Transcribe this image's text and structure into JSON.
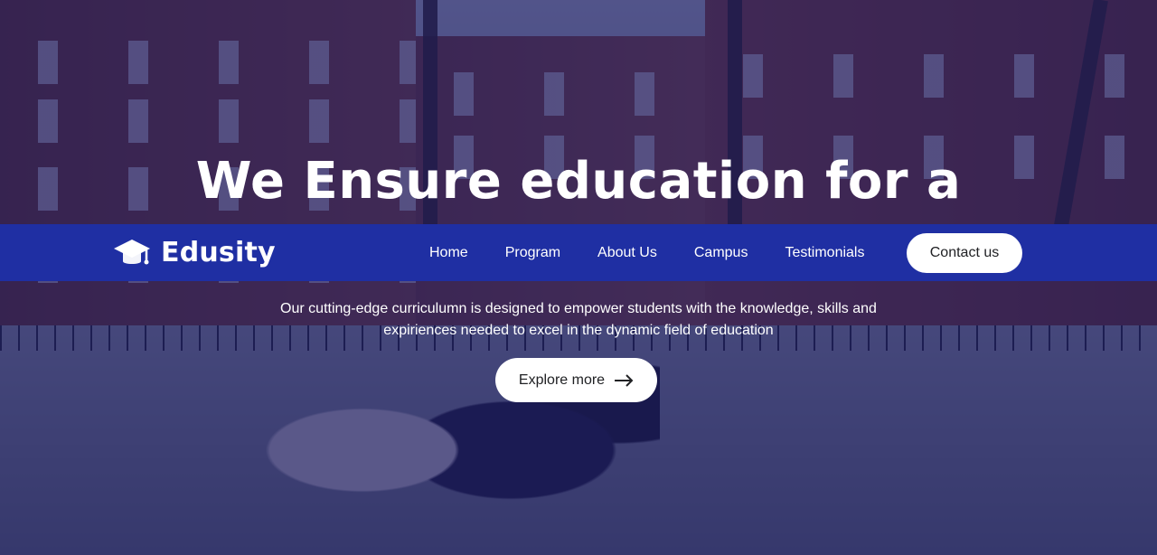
{
  "brand": {
    "name": "Edusity"
  },
  "nav": {
    "items": [
      {
        "label": "Home"
      },
      {
        "label": "Program"
      },
      {
        "label": "About Us"
      },
      {
        "label": "Campus"
      },
      {
        "label": "Testimonials"
      }
    ],
    "cta_label": "Contact us"
  },
  "hero": {
    "title_visible": "We Ensure education for a",
    "subtitle_line1": "Our cutting-edge curriculumn is designed to empower students with the knowledge, skills and",
    "subtitle_line2": "expiriences needed to excel in the dynamic field of education",
    "button_label": "Explore more",
    "button_icon": "arrow-right-icon"
  },
  "colors": {
    "navbar_bg": "#1f2fa3",
    "overlay": "rgba(22,22,95,.68)",
    "white": "#ffffff",
    "text_dark": "#202124"
  }
}
